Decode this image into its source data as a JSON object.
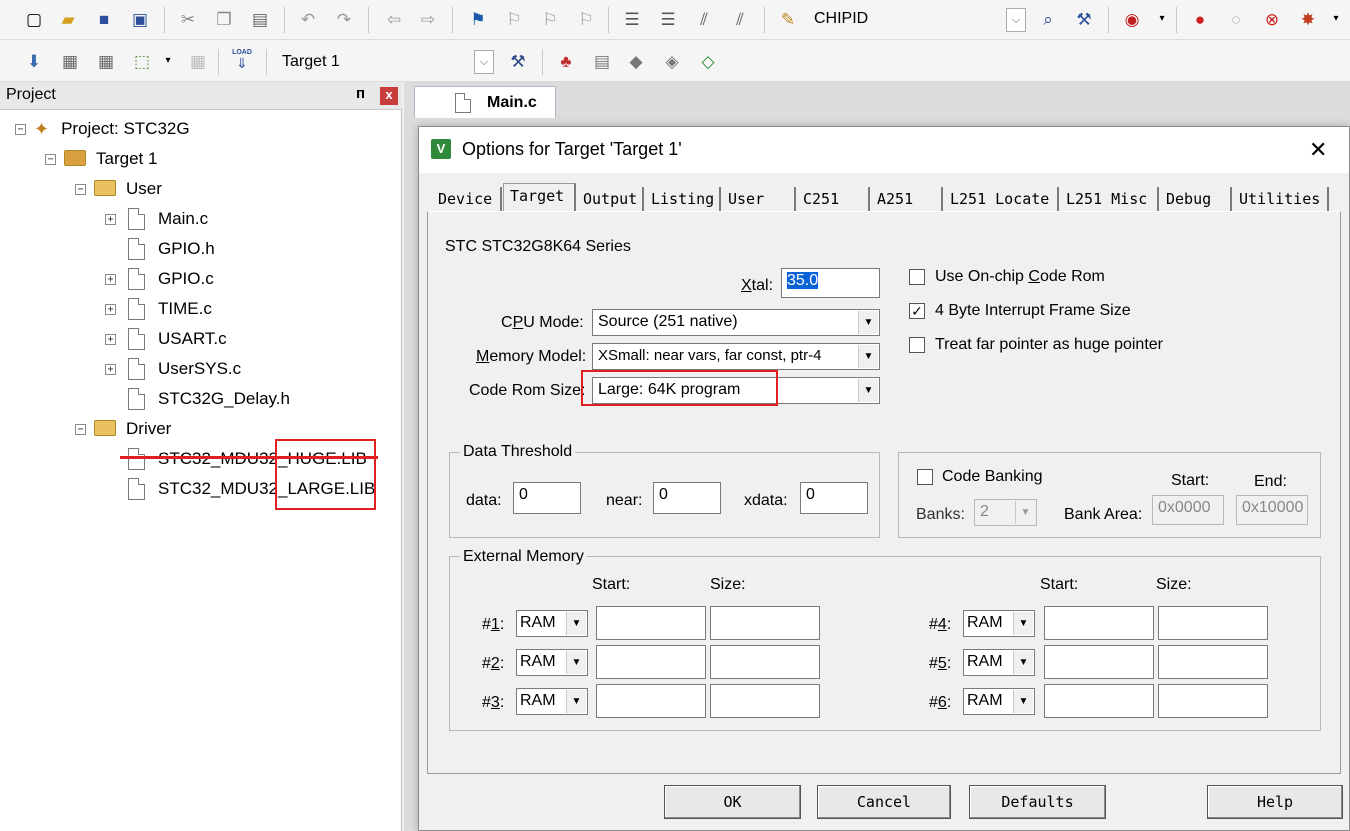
{
  "toolbar1": {
    "chipid_label": "CHIPID",
    "icons": [
      "new-file-icon",
      "open-icon",
      "save-icon",
      "save-all-icon",
      "cut-icon",
      "copy-icon",
      "paste-icon",
      "undo-icon",
      "redo-icon",
      "nav-back-icon",
      "nav-forward-icon",
      "bookmark-icon",
      "bookmark-prev-icon",
      "bookmark-next-icon",
      "bookmark-clear-icon",
      "indent-icon",
      "unindent-icon",
      "comment-icon",
      "uncomment-icon",
      "find-in-files-icon"
    ]
  },
  "toolbar2": {
    "target_select": "Target 1",
    "load_label": "LOAD"
  },
  "project": {
    "header": "Project",
    "pin": "ᴨ",
    "close": "x",
    "root": "Project: STC32G",
    "target": "Target 1",
    "groups": [
      {
        "name": "User",
        "files": [
          "Main.c",
          "GPIO.h",
          "GPIO.c",
          "TIME.c",
          "USART.c",
          "UserSYS.c",
          "STC32G_Delay.h"
        ]
      },
      {
        "name": "Driver",
        "files": [
          "STC32_MDU32_HUGE.LIB",
          "STC32_MDU32_LARGE.LIB"
        ]
      }
    ],
    "expander_plus": "+",
    "expander_minus": "−"
  },
  "editor": {
    "tab_main": "Main.c"
  },
  "dialog": {
    "title": "Options for Target 'Target 1'",
    "close": "✕",
    "tabs": [
      "Device",
      "Target",
      "Output",
      "Listing",
      "User",
      "C251",
      "A251",
      "L251 Locate",
      "L251 Misc",
      "Debug",
      "Utilities"
    ],
    "active_tab": "Target",
    "series": "STC STC32G8K64 Series",
    "xtal_label_pre": "",
    "xtal_label_u": "X",
    "xtal_label_post": "tal:",
    "xtal_value": "35.0",
    "cpu_mode_label_pre": "C",
    "cpu_mode_label_u": "P",
    "cpu_mode_label_post": "U Mode:",
    "cpu_mode_value": "Source (251 native)",
    "memory_model_label_pre": "",
    "memory_model_label_u": "M",
    "memory_model_label_post": "emory Model:",
    "memory_model_value": "XSmall: near vars, far const, ptr-4",
    "code_rom_label": "Code Rom Size:",
    "code_rom_value": "Large: 64K program",
    "opt_onchip_pre": "Use On-chip ",
    "opt_onchip_u": "C",
    "opt_onchip_post": "ode Rom",
    "opt_onchip_checked": false,
    "opt_4byte": "4 Byte Interrupt Frame Size",
    "opt_4byte_checked": true,
    "opt_farptr": "Treat far pointer as huge pointer",
    "opt_farptr_checked": false,
    "check_mark": "✓",
    "data_threshold": {
      "title": "Data Threshold",
      "data_label": "data:",
      "data_value": "0",
      "near_label": "near:",
      "near_value": "0",
      "xdata_label": "xdata:",
      "xdata_value": "0"
    },
    "code_banking": {
      "label": "Code Banking",
      "checked": false,
      "banks_label": "Banks:",
      "banks_value": "2",
      "bank_area_label": "Bank Area:",
      "start_label": "Start:",
      "start_value": "0x0000",
      "end_label": "End:",
      "end_value": "0x10000"
    },
    "external_memory": {
      "title": "External Memory",
      "start_label": "Start:",
      "size_label": "Size:",
      "rows": [
        {
          "label": "#1:",
          "u": "1",
          "type": "RAM"
        },
        {
          "label": "#2:",
          "u": "2",
          "type": "RAM"
        },
        {
          "label": "#3:",
          "u": "3",
          "type": "RAM"
        },
        {
          "label": "#4:",
          "u": "4",
          "type": "RAM"
        },
        {
          "label": "#5:",
          "u": "5",
          "type": "RAM"
        },
        {
          "label": "#6:",
          "u": "6",
          "type": "RAM"
        }
      ]
    },
    "buttons": {
      "ok": "OK",
      "cancel": "Cancel",
      "defaults": "Defaults",
      "help": "Help"
    }
  },
  "annotation_color": "#e02020"
}
